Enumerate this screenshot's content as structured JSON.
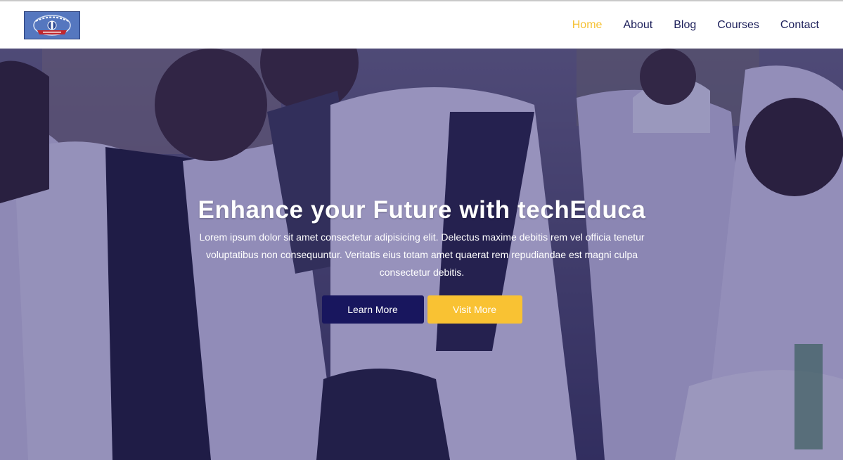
{
  "colors": {
    "brand_navy": "#18165e",
    "brand_yellow": "#f9c233",
    "nav_text": "#1c1f5a",
    "nav_active": "#f5c030",
    "hero_overlay": "#26206e"
  },
  "header": {
    "logo_icon": "school-crest-icon",
    "nav": [
      {
        "label": "Home",
        "active": true
      },
      {
        "label": "About",
        "active": false
      },
      {
        "label": "Blog",
        "active": false
      },
      {
        "label": "Courses",
        "active": false
      },
      {
        "label": "Contact",
        "active": false
      }
    ]
  },
  "hero": {
    "background": "group-of-students-in-lab-coats-photo",
    "title": "Enhance your Future with techEduca",
    "text": "Lorem ipsum dolor sit amet consectetur adipisicing elit. Delectus maxime debitis rem vel officia tenetur voluptatibus non consequuntur. Veritatis eius totam amet quaerat rem repudiandae est magni culpa consectetur debitis.",
    "primary_button": "Learn More",
    "secondary_button": "Visit More"
  }
}
